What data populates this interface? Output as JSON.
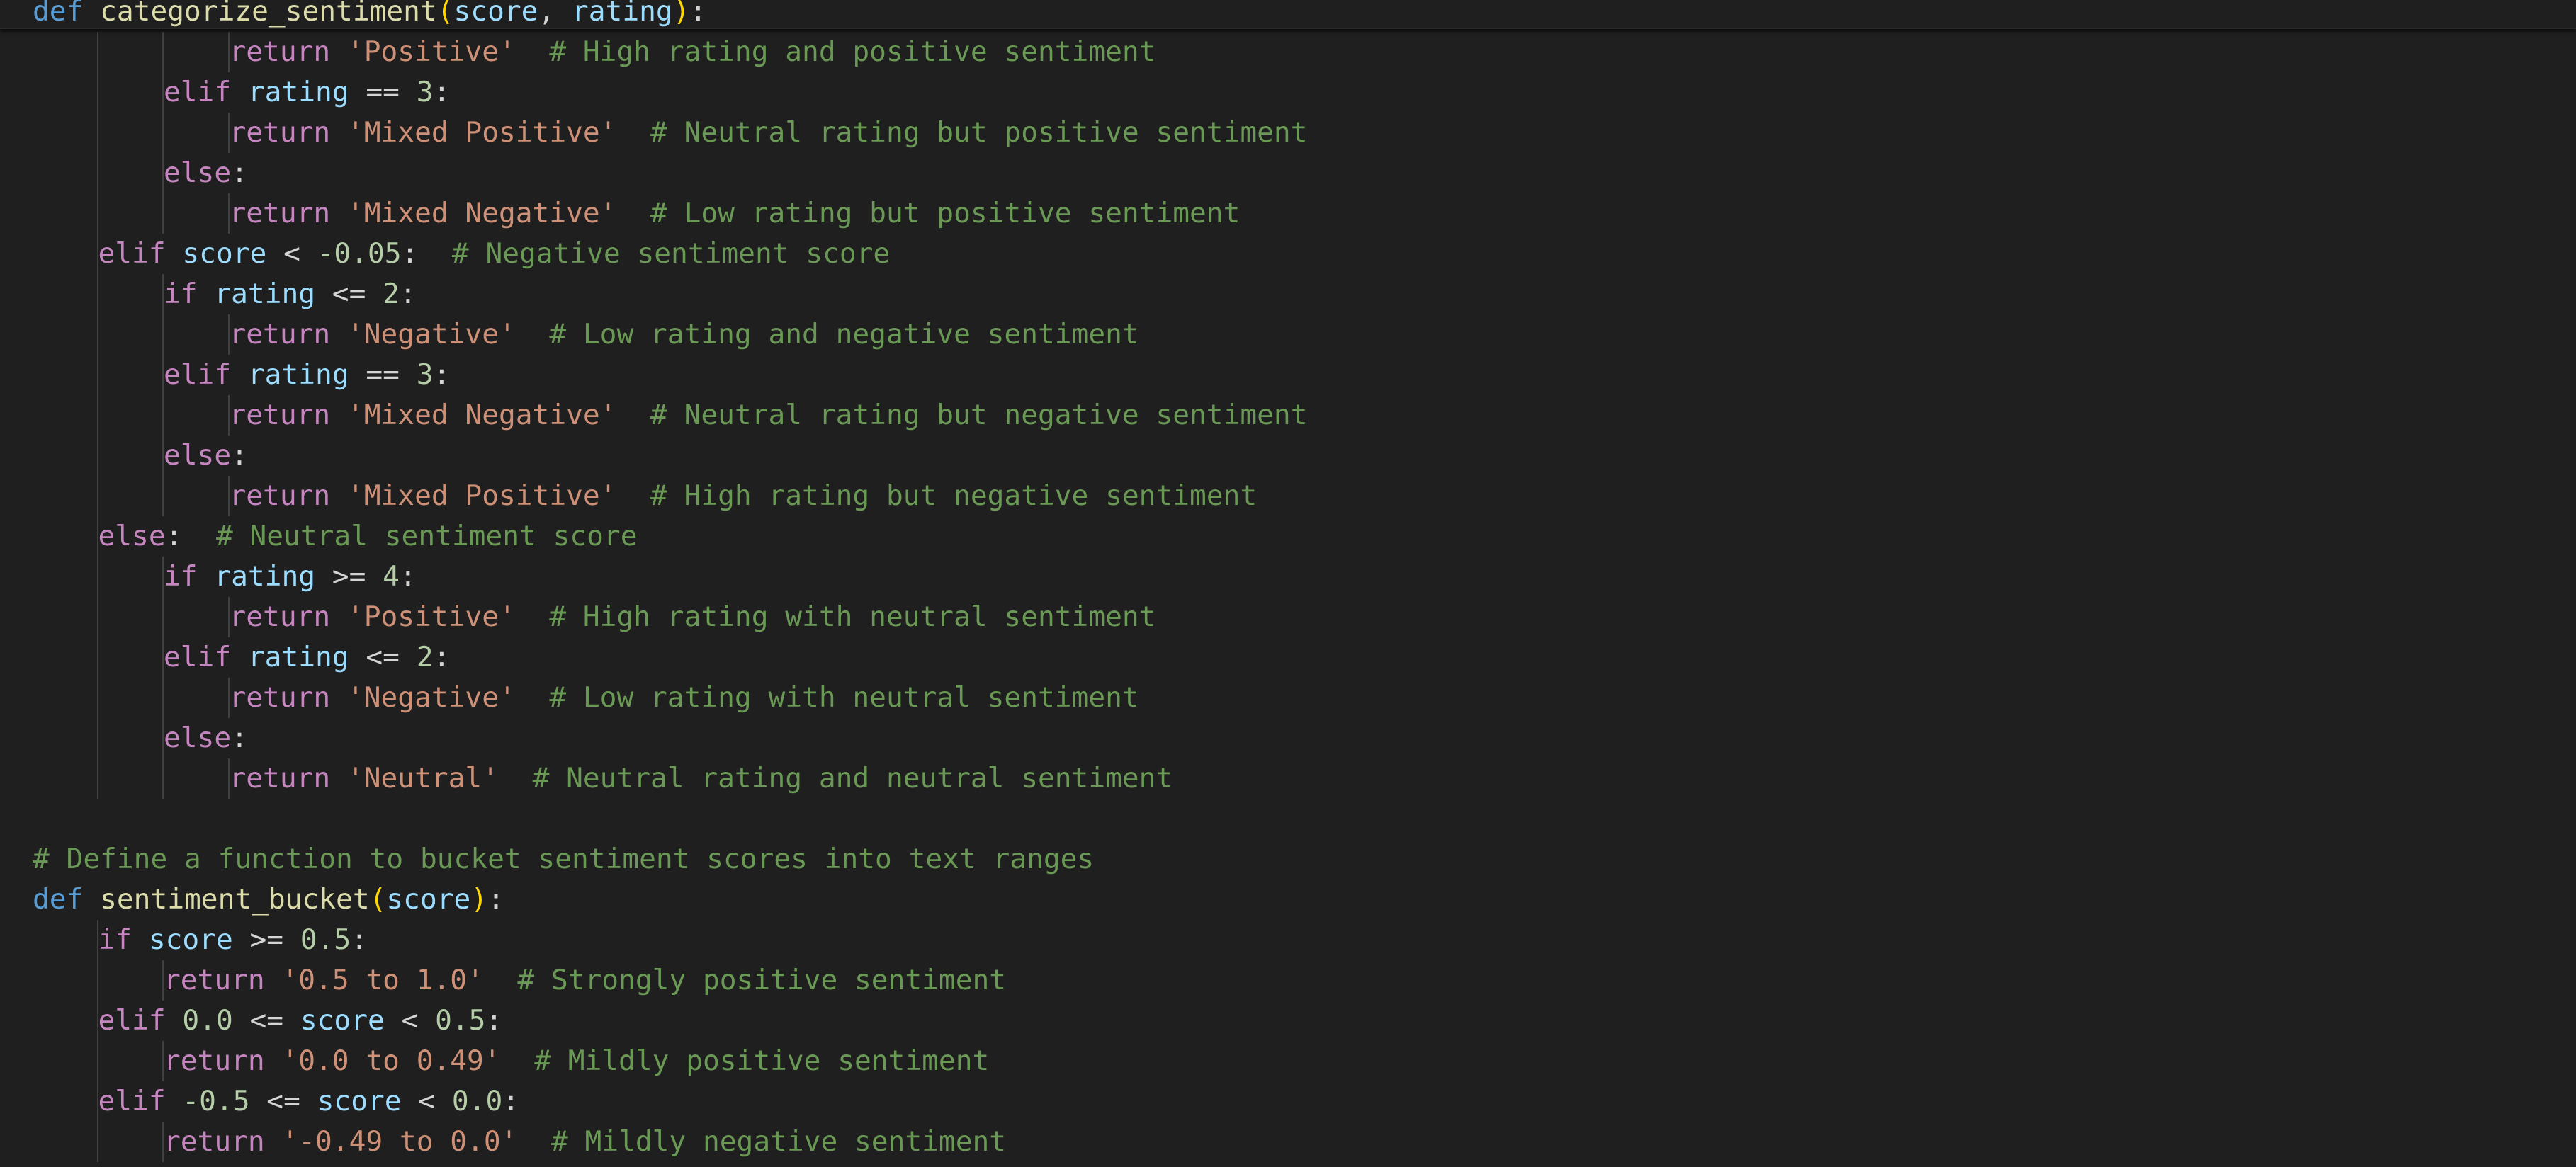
{
  "sticky_header": {
    "line": [
      {
        "t": "def",
        "c": "kw"
      },
      {
        "t": " "
      },
      {
        "t": "categorize_sentiment",
        "c": "fn"
      },
      {
        "t": "(",
        "c": "pn"
      },
      {
        "t": "score",
        "c": "var"
      },
      {
        "t": ", "
      },
      {
        "t": "rating",
        "c": "var"
      },
      {
        "t": ")",
        "c": "pn"
      },
      {
        "t": ":"
      }
    ]
  },
  "lines": [
    {
      "indent": 3,
      "tokens": [
        {
          "t": "return",
          "c": "ctl"
        },
        {
          "t": " "
        },
        {
          "t": "'Positive'",
          "c": "str"
        },
        {
          "t": "  "
        },
        {
          "t": "# High rating and positive sentiment",
          "c": "cmt"
        }
      ]
    },
    {
      "indent": 2,
      "tokens": [
        {
          "t": "elif",
          "c": "ctl"
        },
        {
          "t": " "
        },
        {
          "t": "rating",
          "c": "var"
        },
        {
          "t": " == "
        },
        {
          "t": "3",
          "c": "num"
        },
        {
          "t": ":"
        }
      ]
    },
    {
      "indent": 3,
      "tokens": [
        {
          "t": "return",
          "c": "ctl"
        },
        {
          "t": " "
        },
        {
          "t": "'Mixed Positive'",
          "c": "str"
        },
        {
          "t": "  "
        },
        {
          "t": "# Neutral rating but positive sentiment",
          "c": "cmt"
        }
      ]
    },
    {
      "indent": 2,
      "tokens": [
        {
          "t": "else",
          "c": "ctl"
        },
        {
          "t": ":"
        }
      ]
    },
    {
      "indent": 3,
      "tokens": [
        {
          "t": "return",
          "c": "ctl"
        },
        {
          "t": " "
        },
        {
          "t": "'Mixed Negative'",
          "c": "str"
        },
        {
          "t": "  "
        },
        {
          "t": "# Low rating but positive sentiment",
          "c": "cmt"
        }
      ]
    },
    {
      "indent": 1,
      "tokens": [
        {
          "t": "elif",
          "c": "ctl"
        },
        {
          "t": " "
        },
        {
          "t": "score",
          "c": "var"
        },
        {
          "t": " < "
        },
        {
          "t": "-0.05",
          "c": "num"
        },
        {
          "t": ":  "
        },
        {
          "t": "# Negative sentiment score",
          "c": "cmt"
        }
      ]
    },
    {
      "indent": 2,
      "tokens": [
        {
          "t": "if",
          "c": "ctl"
        },
        {
          "t": " "
        },
        {
          "t": "rating",
          "c": "var"
        },
        {
          "t": " <= "
        },
        {
          "t": "2",
          "c": "num"
        },
        {
          "t": ":"
        }
      ]
    },
    {
      "indent": 3,
      "tokens": [
        {
          "t": "return",
          "c": "ctl"
        },
        {
          "t": " "
        },
        {
          "t": "'Negative'",
          "c": "str"
        },
        {
          "t": "  "
        },
        {
          "t": "# Low rating and negative sentiment",
          "c": "cmt"
        }
      ]
    },
    {
      "indent": 2,
      "tokens": [
        {
          "t": "elif",
          "c": "ctl"
        },
        {
          "t": " "
        },
        {
          "t": "rating",
          "c": "var"
        },
        {
          "t": " == "
        },
        {
          "t": "3",
          "c": "num"
        },
        {
          "t": ":"
        }
      ]
    },
    {
      "indent": 3,
      "tokens": [
        {
          "t": "return",
          "c": "ctl"
        },
        {
          "t": " "
        },
        {
          "t": "'Mixed Negative'",
          "c": "str"
        },
        {
          "t": "  "
        },
        {
          "t": "# Neutral rating but negative sentiment",
          "c": "cmt"
        }
      ]
    },
    {
      "indent": 2,
      "tokens": [
        {
          "t": "else",
          "c": "ctl"
        },
        {
          "t": ":"
        }
      ]
    },
    {
      "indent": 3,
      "tokens": [
        {
          "t": "return",
          "c": "ctl"
        },
        {
          "t": " "
        },
        {
          "t": "'Mixed Positive'",
          "c": "str"
        },
        {
          "t": "  "
        },
        {
          "t": "# High rating but negative sentiment",
          "c": "cmt"
        }
      ]
    },
    {
      "indent": 1,
      "tokens": [
        {
          "t": "else",
          "c": "ctl"
        },
        {
          "t": ":  "
        },
        {
          "t": "# Neutral sentiment score",
          "c": "cmt"
        }
      ]
    },
    {
      "indent": 2,
      "tokens": [
        {
          "t": "if",
          "c": "ctl"
        },
        {
          "t": " "
        },
        {
          "t": "rating",
          "c": "var"
        },
        {
          "t": " >= "
        },
        {
          "t": "4",
          "c": "num"
        },
        {
          "t": ":"
        }
      ]
    },
    {
      "indent": 3,
      "tokens": [
        {
          "t": "return",
          "c": "ctl"
        },
        {
          "t": " "
        },
        {
          "t": "'Positive'",
          "c": "str"
        },
        {
          "t": "  "
        },
        {
          "t": "# High rating with neutral sentiment",
          "c": "cmt"
        }
      ]
    },
    {
      "indent": 2,
      "tokens": [
        {
          "t": "elif",
          "c": "ctl"
        },
        {
          "t": " "
        },
        {
          "t": "rating",
          "c": "var"
        },
        {
          "t": " <= "
        },
        {
          "t": "2",
          "c": "num"
        },
        {
          "t": ":"
        }
      ]
    },
    {
      "indent": 3,
      "tokens": [
        {
          "t": "return",
          "c": "ctl"
        },
        {
          "t": " "
        },
        {
          "t": "'Negative'",
          "c": "str"
        },
        {
          "t": "  "
        },
        {
          "t": "# Low rating with neutral sentiment",
          "c": "cmt"
        }
      ]
    },
    {
      "indent": 2,
      "tokens": [
        {
          "t": "else",
          "c": "ctl"
        },
        {
          "t": ":"
        }
      ]
    },
    {
      "indent": 3,
      "tokens": [
        {
          "t": "return",
          "c": "ctl"
        },
        {
          "t": " "
        },
        {
          "t": "'Neutral'",
          "c": "str"
        },
        {
          "t": "  "
        },
        {
          "t": "# Neutral rating and neutral sentiment",
          "c": "cmt"
        }
      ]
    },
    {
      "indent": 0,
      "tokens": []
    },
    {
      "indent": 0,
      "tokens": [
        {
          "t": "# Define a function to bucket sentiment scores into text ranges",
          "c": "cmt"
        }
      ]
    },
    {
      "indent": 0,
      "tokens": [
        {
          "t": "def",
          "c": "kw"
        },
        {
          "t": " "
        },
        {
          "t": "sentiment_bucket",
          "c": "fn"
        },
        {
          "t": "(",
          "c": "pn"
        },
        {
          "t": "score",
          "c": "var"
        },
        {
          "t": ")",
          "c": "pn"
        },
        {
          "t": ":"
        }
      ]
    },
    {
      "indent": 1,
      "tokens": [
        {
          "t": "if",
          "c": "ctl"
        },
        {
          "t": " "
        },
        {
          "t": "score",
          "c": "var"
        },
        {
          "t": " >= "
        },
        {
          "t": "0.5",
          "c": "num"
        },
        {
          "t": ":"
        }
      ]
    },
    {
      "indent": 2,
      "tokens": [
        {
          "t": "return",
          "c": "ctl"
        },
        {
          "t": " "
        },
        {
          "t": "'0.5 to 1.0'",
          "c": "str"
        },
        {
          "t": "  "
        },
        {
          "t": "# Strongly positive sentiment",
          "c": "cmt"
        }
      ]
    },
    {
      "indent": 1,
      "tokens": [
        {
          "t": "elif",
          "c": "ctl"
        },
        {
          "t": " "
        },
        {
          "t": "0.0",
          "c": "num"
        },
        {
          "t": " <= "
        },
        {
          "t": "score",
          "c": "var"
        },
        {
          "t": " < "
        },
        {
          "t": "0.5",
          "c": "num"
        },
        {
          "t": ":"
        }
      ]
    },
    {
      "indent": 2,
      "tokens": [
        {
          "t": "return",
          "c": "ctl"
        },
        {
          "t": " "
        },
        {
          "t": "'0.0 to 0.49'",
          "c": "str"
        },
        {
          "t": "  "
        },
        {
          "t": "# Mildly positive sentiment",
          "c": "cmt"
        }
      ]
    },
    {
      "indent": 1,
      "tokens": [
        {
          "t": "elif",
          "c": "ctl"
        },
        {
          "t": " "
        },
        {
          "t": "-0.5",
          "c": "num"
        },
        {
          "t": " <= "
        },
        {
          "t": "score",
          "c": "var"
        },
        {
          "t": " < "
        },
        {
          "t": "0.0",
          "c": "num"
        },
        {
          "t": ":"
        }
      ]
    },
    {
      "indent": 2,
      "tokens": [
        {
          "t": "return",
          "c": "ctl"
        },
        {
          "t": " "
        },
        {
          "t": "'-0.49 to 0.0'",
          "c": "str"
        },
        {
          "t": "  "
        },
        {
          "t": "# Mildly negative sentiment",
          "c": "cmt"
        }
      ]
    }
  ]
}
